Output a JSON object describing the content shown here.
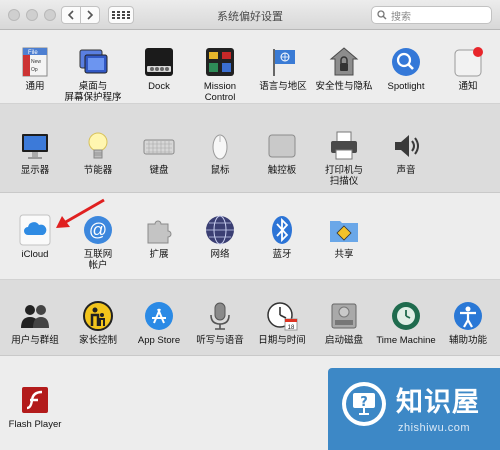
{
  "window": {
    "title": "系统偏好设置"
  },
  "search": {
    "placeholder": "搜索"
  },
  "rows": [
    [
      {
        "label": "通用",
        "icon": "general-icon"
      },
      {
        "label": "桌面与\n屏幕保护程序",
        "icon": "desktop-screensaver-icon"
      },
      {
        "label": "Dock",
        "icon": "dock-icon"
      },
      {
        "label": "Mission\nControl",
        "icon": "mission-control-icon"
      },
      {
        "label": "语言与地区",
        "icon": "language-region-icon"
      },
      {
        "label": "安全性与隐私",
        "icon": "security-privacy-icon"
      },
      {
        "label": "Spotlight",
        "icon": "spotlight-icon"
      },
      {
        "label": "通知",
        "icon": "notifications-icon"
      }
    ],
    [
      {
        "label": "显示器",
        "icon": "displays-icon"
      },
      {
        "label": "节能器",
        "icon": "energy-saver-icon"
      },
      {
        "label": "键盘",
        "icon": "keyboard-icon"
      },
      {
        "label": "鼠标",
        "icon": "mouse-icon"
      },
      {
        "label": "触控板",
        "icon": "trackpad-icon"
      },
      {
        "label": "打印机与\n扫描仪",
        "icon": "printers-scanners-icon"
      },
      {
        "label": "声音",
        "icon": "sound-icon"
      }
    ],
    [
      {
        "label": "iCloud",
        "icon": "icloud-icon"
      },
      {
        "label": "互联网\n帐户",
        "icon": "internet-accounts-icon"
      },
      {
        "label": "扩展",
        "icon": "extensions-icon"
      },
      {
        "label": "网络",
        "icon": "network-icon"
      },
      {
        "label": "蓝牙",
        "icon": "bluetooth-icon"
      },
      {
        "label": "共享",
        "icon": "sharing-icon"
      }
    ],
    [
      {
        "label": "用户与群组",
        "icon": "users-groups-icon"
      },
      {
        "label": "家长控制",
        "icon": "parental-controls-icon"
      },
      {
        "label": "App Store",
        "icon": "app-store-icon"
      },
      {
        "label": "听写与语音",
        "icon": "dictation-speech-icon"
      },
      {
        "label": "日期与时间",
        "icon": "date-time-icon"
      },
      {
        "label": "启动磁盘",
        "icon": "startup-disk-icon"
      },
      {
        "label": "Time Machine",
        "icon": "time-machine-icon"
      },
      {
        "label": "辅助功能",
        "icon": "accessibility-icon"
      }
    ],
    [
      {
        "label": "Flash Player",
        "icon": "flash-player-icon"
      }
    ]
  ],
  "annotation": {
    "color": "#e02020",
    "target": "iCloud"
  },
  "watermark": {
    "title": "知识屋",
    "url": "zhishiwu.com"
  }
}
